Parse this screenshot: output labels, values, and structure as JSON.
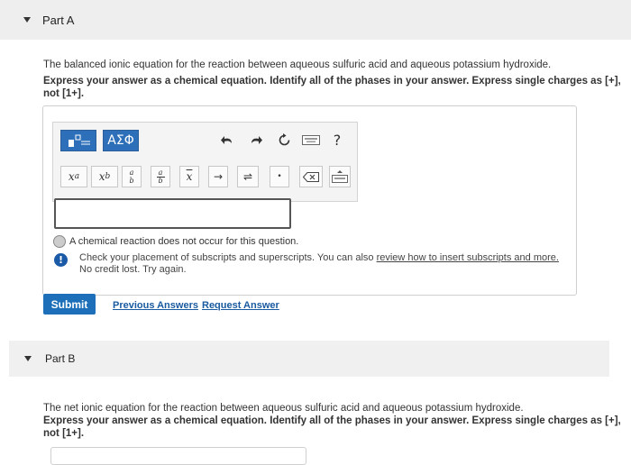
{
  "part_a": {
    "title": "Part A",
    "question": "The balanced ionic equation for the reaction between aqueous sulfuric acid and aqueous potassium hydroxide.",
    "instruction_line1": "Express your answer as a chemical equation. Identify all of the phases in your answer. Express single charges as [+],",
    "instruction_line2": "not [1+]."
  },
  "toolbar": {
    "greek_label": "ΑΣΦ",
    "help_label": "?",
    "superscript": "x",
    "superscript_exp": "a",
    "subscript": "x",
    "subscript_sub": "b",
    "frac_num": "a",
    "frac_den": "b",
    "vec_label": "x",
    "arrow_label": "→",
    "equilibrium_label": "⇌",
    "dot_label": "•"
  },
  "answer": {
    "input_value": "",
    "no_reaction_label": "A chemical reaction does not occur for this question.",
    "feedback_line1_prefix": "Check your placement of subscripts and superscripts. You can also ",
    "feedback_link": "review how to insert subscripts and more.",
    "feedback_line2": "No credit lost. Try again."
  },
  "actions": {
    "submit": "Submit",
    "previous_answers": "Previous Answers",
    "request_answer": "Request Answer"
  },
  "part_b": {
    "title": "Part B",
    "question": "The net ionic equation for the reaction between aqueous sulfuric acid and aqueous potassium hydroxide.",
    "instruction_line1": "Express your answer as a chemical equation. Identify all of the phases in your answer. Express single charges as [+],",
    "instruction_line2": "not [1+]."
  },
  "colors": {
    "accent": "#2d6fb8",
    "link": "#1a5aa0",
    "header_bg": "#eeeeee"
  }
}
